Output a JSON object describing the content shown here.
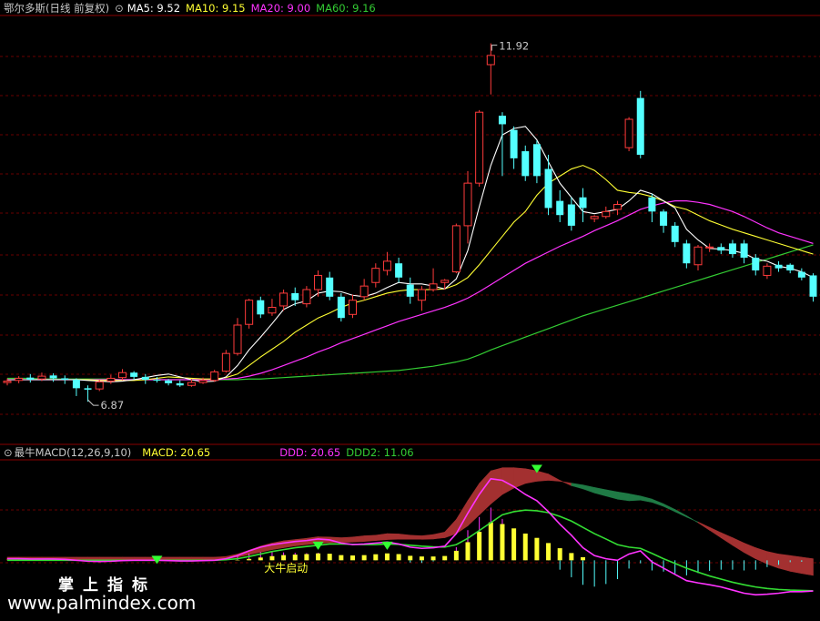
{
  "header": {
    "stock": "鄂尔多斯(日线 前复权)",
    "ma5": "MA5: 9.52",
    "ma10": "MA10: 9.15",
    "ma20": "MA20: 9.00",
    "ma60": "MA60: 9.16"
  },
  "sub_header": {
    "indicator": "最牛MACD(12,26,9,10)",
    "macd": "MACD: 20.65",
    "ddd": "DDD: 20.65",
    "ddd2": "DDD2: 11.06"
  },
  "annotations": {
    "high": "11.92",
    "low": "6.87",
    "signal": "大牛启动"
  },
  "watermark": {
    "title": "掌上指标",
    "url": "www.palmindex.com"
  },
  "colors": {
    "up": "#ff3b3b",
    "down": "#54ffff",
    "ma5": "#ffffff",
    "ma10": "#ffff33",
    "ma20": "#ff33ff",
    "ma60": "#33cc33",
    "grid": "#6a0000",
    "text": "#c8c8c8"
  },
  "chart_data": [
    {
      "type": "candlestick",
      "title": "鄂尔多斯(日线 前复权)",
      "ylim": [
        6.5,
        12.3
      ],
      "candles": [
        [
          7.14,
          7.16,
          7.2,
          7.1
        ],
        [
          7.17,
          7.2,
          7.23,
          7.13
        ],
        [
          7.21,
          7.18,
          7.26,
          7.14
        ],
        [
          7.19,
          7.23,
          7.28,
          7.16
        ],
        [
          7.24,
          7.2,
          7.27,
          7.15
        ],
        [
          7.2,
          7.18,
          7.24,
          7.12
        ],
        [
          7.18,
          7.06,
          7.2,
          6.95
        ],
        [
          7.06,
          7.04,
          7.1,
          6.87
        ],
        [
          7.05,
          7.15,
          7.18,
          7.02
        ],
        [
          7.16,
          7.2,
          7.25,
          7.12
        ],
        [
          7.21,
          7.28,
          7.33,
          7.17
        ],
        [
          7.28,
          7.22,
          7.3,
          7.18
        ],
        [
          7.22,
          7.18,
          7.26,
          7.12
        ],
        [
          7.18,
          7.17,
          7.22,
          7.14
        ],
        [
          7.17,
          7.13,
          7.19,
          7.1
        ],
        [
          7.13,
          7.1,
          7.17,
          7.08
        ],
        [
          7.1,
          7.14,
          7.19,
          7.08
        ],
        [
          7.14,
          7.17,
          7.21,
          7.12
        ],
        [
          7.17,
          7.29,
          7.32,
          7.15
        ],
        [
          7.3,
          7.55,
          7.6,
          7.28
        ],
        [
          7.55,
          7.95,
          8.05,
          7.52
        ],
        [
          7.96,
          8.3,
          8.32,
          7.9
        ],
        [
          8.3,
          8.1,
          8.35,
          8.05
        ],
        [
          8.12,
          8.2,
          8.32,
          8.08
        ],
        [
          8.22,
          8.4,
          8.45,
          8.15
        ],
        [
          8.4,
          8.3,
          8.48,
          8.22
        ],
        [
          8.25,
          8.45,
          8.5,
          8.2
        ],
        [
          8.45,
          8.65,
          8.72,
          8.35
        ],
        [
          8.62,
          8.35,
          8.7,
          8.3
        ],
        [
          8.35,
          8.05,
          8.4,
          8.0
        ],
        [
          8.1,
          8.3,
          8.38,
          8.05
        ],
        [
          8.35,
          8.5,
          8.6,
          8.3
        ],
        [
          8.55,
          8.75,
          8.82,
          8.48
        ],
        [
          8.72,
          8.85,
          8.98,
          8.65
        ],
        [
          8.82,
          8.62,
          8.9,
          8.55
        ],
        [
          8.52,
          8.35,
          8.62,
          8.25
        ],
        [
          8.3,
          8.45,
          8.5,
          8.15
        ],
        [
          8.45,
          8.53,
          8.75,
          8.42
        ],
        [
          8.55,
          8.58,
          8.6,
          8.45
        ],
        [
          8.7,
          9.35,
          9.38,
          8.68
        ],
        [
          9.35,
          9.95,
          10.12,
          9.1
        ],
        [
          9.95,
          10.95,
          10.98,
          9.9
        ],
        [
          11.62,
          11.75,
          11.92,
          11.2
        ],
        [
          10.9,
          10.78,
          10.95,
          10.05
        ],
        [
          10.7,
          10.3,
          10.75,
          10.15
        ],
        [
          10.4,
          10.05,
          10.48,
          9.98
        ],
        [
          10.5,
          10.05,
          10.55,
          9.95
        ],
        [
          10.15,
          9.6,
          10.35,
          9.5
        ],
        [
          9.7,
          9.5,
          9.85,
          9.4
        ],
        [
          9.65,
          9.35,
          9.75,
          9.28
        ],
        [
          9.75,
          9.6,
          9.88,
          9.4
        ],
        [
          9.45,
          9.48,
          9.5,
          9.4
        ],
        [
          9.48,
          9.55,
          9.62,
          9.45
        ],
        [
          9.58,
          9.65,
          9.7,
          9.5
        ],
        [
          10.45,
          10.85,
          10.88,
          10.4
        ],
        [
          11.15,
          10.35,
          11.25,
          10.3
        ],
        [
          9.75,
          9.55,
          9.8,
          9.4
        ],
        [
          9.55,
          9.35,
          9.58,
          9.25
        ],
        [
          9.35,
          9.12,
          9.4,
          9.05
        ],
        [
          9.1,
          8.82,
          9.15,
          8.75
        ],
        [
          8.8,
          9.05,
          9.08,
          8.72
        ],
        [
          9.05,
          9.05,
          9.1,
          8.98
        ],
        [
          9.05,
          9.0,
          9.1,
          8.95
        ],
        [
          9.1,
          8.95,
          9.15,
          8.9
        ],
        [
          9.1,
          8.9,
          9.15,
          8.82
        ],
        [
          8.9,
          8.72,
          8.95,
          8.65
        ],
        [
          8.65,
          8.78,
          8.82,
          8.6
        ],
        [
          8.8,
          8.75,
          8.85,
          8.7
        ],
        [
          8.8,
          8.72,
          8.82,
          8.68
        ],
        [
          8.7,
          8.62,
          8.75,
          8.58
        ],
        [
          8.65,
          8.35,
          8.68,
          8.28
        ]
      ],
      "series": [
        {
          "name": "MA5",
          "values": [
            7.18,
            7.18,
            7.18,
            7.18,
            7.18,
            7.18,
            7.18,
            7.17,
            7.16,
            7.15,
            7.16,
            7.18,
            7.21,
            7.24,
            7.26,
            7.22,
            7.18,
            7.15,
            7.16,
            7.22,
            7.38,
            7.6,
            7.78,
            7.97,
            8.17,
            8.25,
            8.29,
            8.4,
            8.43,
            8.42,
            8.37,
            8.35,
            8.4,
            8.48,
            8.55,
            8.53,
            8.53,
            8.5,
            8.46,
            8.6,
            9.0,
            9.62,
            10.2,
            10.63,
            10.72,
            10.75,
            10.56,
            10.25,
            9.95,
            9.75,
            9.55,
            9.52,
            9.55,
            9.58,
            9.7,
            9.85,
            9.8,
            9.7,
            9.6,
            9.3,
            9.15,
            9.03,
            9.02,
            9.0,
            8.96,
            8.88,
            8.85,
            8.78,
            8.75,
            8.7,
            8.62
          ]
        },
        {
          "name": "MA10",
          "values": [
            7.18,
            7.18,
            7.18,
            7.18,
            7.18,
            7.18,
            7.18,
            7.18,
            7.17,
            7.17,
            7.17,
            7.17,
            7.18,
            7.2,
            7.22,
            7.21,
            7.2,
            7.19,
            7.19,
            7.21,
            7.26,
            7.38,
            7.5,
            7.61,
            7.72,
            7.85,
            7.95,
            8.05,
            8.12,
            8.2,
            8.26,
            8.3,
            8.35,
            8.4,
            8.43,
            8.45,
            8.45,
            8.45,
            8.46,
            8.52,
            8.62,
            8.8,
            9.0,
            9.2,
            9.4,
            9.55,
            9.78,
            9.95,
            10.05,
            10.15,
            10.2,
            10.13,
            10.0,
            9.85,
            9.82,
            9.8,
            9.76,
            9.7,
            9.62,
            9.58,
            9.5,
            9.42,
            9.36,
            9.3,
            9.25,
            9.2,
            9.15,
            9.1,
            9.05,
            9.0,
            8.95
          ]
        },
        {
          "name": "MA20",
          "values": [
            7.18,
            7.18,
            7.18,
            7.18,
            7.18,
            7.18,
            7.18,
            7.18,
            7.18,
            7.18,
            7.18,
            7.18,
            7.18,
            7.18,
            7.18,
            7.18,
            7.18,
            7.18,
            7.18,
            7.19,
            7.2,
            7.23,
            7.27,
            7.32,
            7.38,
            7.44,
            7.5,
            7.57,
            7.63,
            7.7,
            7.76,
            7.82,
            7.88,
            7.94,
            8.0,
            8.05,
            8.1,
            8.15,
            8.2,
            8.26,
            8.33,
            8.42,
            8.52,
            8.62,
            8.72,
            8.82,
            8.9,
            8.98,
            9.06,
            9.13,
            9.2,
            9.28,
            9.35,
            9.42,
            9.5,
            9.58,
            9.63,
            9.67,
            9.7,
            9.7,
            9.68,
            9.65,
            9.6,
            9.55,
            9.48,
            9.4,
            9.32,
            9.25,
            9.2,
            9.15,
            9.1
          ]
        },
        {
          "name": "MA60",
          "values": [
            7.2,
            7.2,
            7.2,
            7.19,
            7.19,
            7.19,
            7.19,
            7.19,
            7.19,
            7.19,
            7.18,
            7.18,
            7.18,
            7.18,
            7.18,
            7.18,
            7.18,
            7.18,
            7.18,
            7.18,
            7.18,
            7.19,
            7.19,
            7.2,
            7.21,
            7.22,
            7.23,
            7.24,
            7.25,
            7.26,
            7.27,
            7.28,
            7.29,
            7.3,
            7.31,
            7.33,
            7.35,
            7.37,
            7.4,
            7.43,
            7.47,
            7.53,
            7.6,
            7.66,
            7.72,
            7.78,
            7.84,
            7.9,
            7.96,
            8.02,
            8.08,
            8.13,
            8.18,
            8.23,
            8.28,
            8.33,
            8.38,
            8.43,
            8.48,
            8.53,
            8.58,
            8.63,
            8.68,
            8.73,
            8.78,
            8.83,
            8.88,
            8.93,
            8.98,
            9.03,
            9.08
          ]
        }
      ]
    },
    {
      "type": "area",
      "title": "最牛MACD(12,26,9,10)",
      "ylim": [
        -1.5,
        3.0
      ],
      "series": [
        {
          "name": "MACD",
          "values": [
            0,
            0,
            0,
            0,
            0,
            0,
            0,
            0,
            0,
            0,
            0,
            0,
            0,
            0,
            0,
            0,
            0,
            0,
            0,
            0,
            0.02,
            0.08,
            0.16,
            0.24,
            0.3,
            0.33,
            0.36,
            0.4,
            0.38,
            0.3,
            0.28,
            0.3,
            0.35,
            0.4,
            0.36,
            0.26,
            0.22,
            0.22,
            0.25,
            0.55,
            1.05,
            1.65,
            2.2,
            2.1,
            1.85,
            1.55,
            1.3,
            1.0,
            0.7,
            0.42,
            0.18,
            0,
            0,
            0,
            0,
            0,
            0,
            0,
            0,
            0,
            0,
            0,
            0,
            0,
            0,
            0,
            0,
            0,
            0,
            0,
            0
          ]
        },
        {
          "name": "DDD",
          "values": [
            0.05,
            0.05,
            0.04,
            0.04,
            0.04,
            0.03,
            0.0,
            -0.03,
            -0.04,
            -0.03,
            -0.01,
            0.0,
            0.0,
            0.0,
            -0.01,
            -0.02,
            -0.02,
            -0.01,
            0.0,
            0.05,
            0.15,
            0.3,
            0.42,
            0.5,
            0.55,
            0.6,
            0.63,
            0.68,
            0.65,
            0.55,
            0.5,
            0.52,
            0.55,
            0.58,
            0.52,
            0.42,
            0.38,
            0.4,
            0.45,
            0.85,
            1.5,
            2.1,
            2.6,
            2.55,
            2.35,
            2.1,
            1.9,
            1.55,
            1.15,
            0.8,
            0.4,
            0.15,
            0.05,
            0.0,
            0.2,
            0.3,
            -0.05,
            -0.25,
            -0.45,
            -0.65,
            -0.72,
            -0.78,
            -0.85,
            -0.95,
            -1.05,
            -1.1,
            -1.08,
            -1.05,
            -1.0,
            -1.0,
            -0.98
          ]
        },
        {
          "name": "DDD2",
          "values": [
            0.0,
            0.0,
            0.0,
            0.0,
            0.0,
            0.0,
            0.0,
            0.0,
            0.0,
            0.0,
            0.0,
            0.0,
            0.0,
            0.0,
            0.0,
            0.0,
            0.0,
            0.0,
            0.0,
            0.02,
            0.05,
            0.12,
            0.2,
            0.28,
            0.34,
            0.4,
            0.44,
            0.48,
            0.52,
            0.52,
            0.51,
            0.5,
            0.5,
            0.52,
            0.51,
            0.48,
            0.45,
            0.43,
            0.42,
            0.5,
            0.7,
            0.95,
            1.2,
            1.45,
            1.55,
            1.6,
            1.58,
            1.52,
            1.4,
            1.25,
            1.05,
            0.85,
            0.68,
            0.5,
            0.42,
            0.38,
            0.22,
            0.05,
            -0.1,
            -0.25,
            -0.38,
            -0.5,
            -0.6,
            -0.7,
            -0.78,
            -0.85,
            -0.9,
            -0.93,
            -0.95,
            -0.96,
            -0.97
          ]
        },
        {
          "name": "ribbon",
          "values": [
            0.1,
            0.1,
            0.1,
            0.1,
            0.1,
            0.1,
            0.1,
            0.1,
            0.1,
            0.1,
            0.1,
            0.1,
            0.1,
            0.1,
            0.1,
            0.1,
            0.1,
            0.1,
            0.1,
            0.12,
            0.2,
            0.32,
            0.45,
            0.55,
            0.62,
            0.66,
            0.7,
            0.75,
            0.74,
            0.72,
            0.74,
            0.78,
            0.8,
            0.85,
            0.84,
            0.8,
            0.78,
            0.82,
            0.9,
            1.3,
            1.9,
            2.45,
            2.85,
            2.95,
            2.95,
            2.92,
            2.85,
            2.75,
            2.55,
            2.38,
            2.28,
            2.15,
            2.05,
            1.95,
            1.9,
            1.92,
            1.85,
            1.72,
            1.55,
            1.38,
            1.22,
            1.05,
            0.88,
            0.72,
            0.55,
            0.4,
            0.28,
            0.2,
            0.15,
            0.1,
            0.05
          ]
        },
        {
          "name": "ribbon2",
          "values": [
            0.02,
            0.02,
            0.02,
            0.02,
            0.02,
            0.02,
            0.02,
            0.02,
            0.02,
            0.02,
            0.02,
            0.02,
            0.02,
            0.02,
            0.02,
            0.02,
            0.02,
            0.02,
            0.02,
            0.05,
            0.1,
            0.18,
            0.26,
            0.34,
            0.4,
            0.46,
            0.5,
            0.54,
            0.56,
            0.57,
            0.58,
            0.6,
            0.63,
            0.66,
            0.67,
            0.67,
            0.67,
            0.68,
            0.72,
            0.85,
            1.1,
            1.45,
            1.8,
            2.1,
            2.3,
            2.45,
            2.52,
            2.55,
            2.52,
            2.46,
            2.4,
            2.32,
            2.25,
            2.18,
            2.12,
            2.05,
            1.95,
            1.8,
            1.62,
            1.42,
            1.2,
            0.96,
            0.72,
            0.48,
            0.25,
            0.05,
            -0.12,
            -0.25,
            -0.35,
            -0.42,
            -0.48
          ]
        }
      ]
    }
  ]
}
